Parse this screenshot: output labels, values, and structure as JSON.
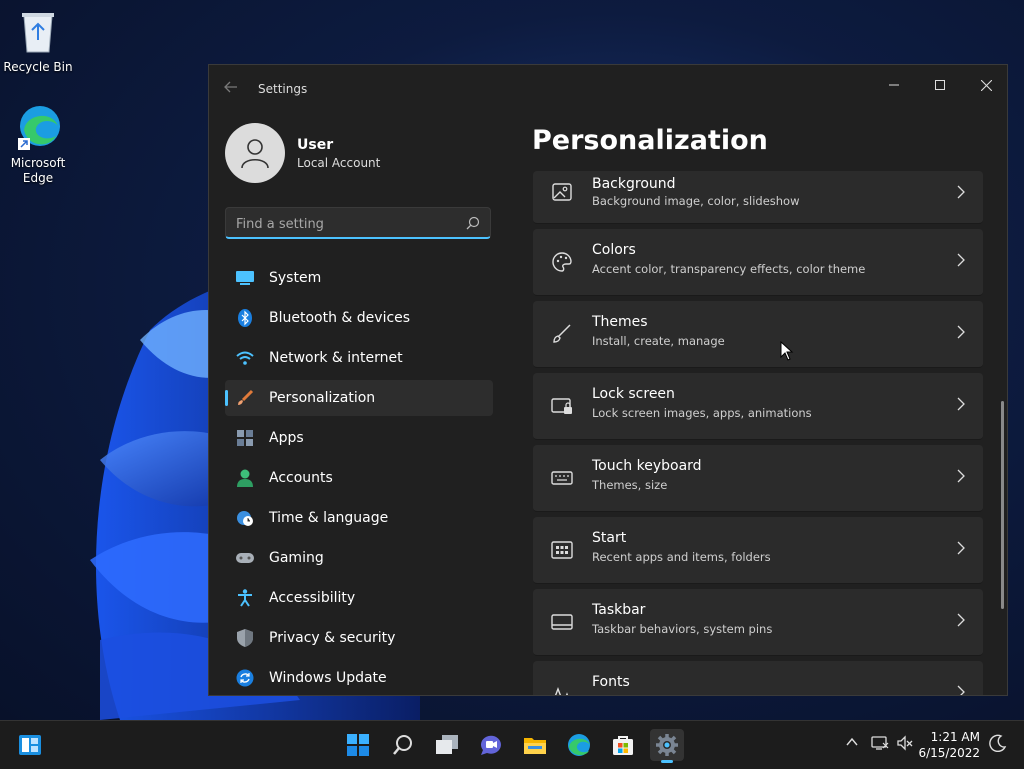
{
  "desktop": {
    "icons": [
      {
        "label": "Recycle Bin"
      },
      {
        "label": "Microsoft Edge"
      }
    ]
  },
  "window": {
    "title": "Settings",
    "user": {
      "name": "User",
      "account_type": "Local Account"
    },
    "search": {
      "placeholder": "Find a setting",
      "value": ""
    },
    "nav": [
      {
        "label": "System",
        "icon": "system-icon"
      },
      {
        "label": "Bluetooth & devices",
        "icon": "bluetooth-icon"
      },
      {
        "label": "Network & internet",
        "icon": "wifi-icon"
      },
      {
        "label": "Personalization",
        "icon": "brush-icon",
        "active": true
      },
      {
        "label": "Apps",
        "icon": "apps-icon"
      },
      {
        "label": "Accounts",
        "icon": "accounts-icon"
      },
      {
        "label": "Time & language",
        "icon": "globe-clock-icon"
      },
      {
        "label": "Gaming",
        "icon": "gamepad-icon"
      },
      {
        "label": "Accessibility",
        "icon": "accessibility-icon"
      },
      {
        "label": "Privacy & security",
        "icon": "shield-icon"
      },
      {
        "label": "Windows Update",
        "icon": "update-icon"
      }
    ],
    "page_title": "Personalization",
    "cards": [
      {
        "title": "Background",
        "subtitle": "Background image, color, slideshow",
        "icon": "image-icon"
      },
      {
        "title": "Colors",
        "subtitle": "Accent color, transparency effects, color theme",
        "icon": "palette-icon"
      },
      {
        "title": "Themes",
        "subtitle": "Install, create, manage",
        "icon": "brush-icon"
      },
      {
        "title": "Lock screen",
        "subtitle": "Lock screen images, apps, animations",
        "icon": "lock-screen-icon"
      },
      {
        "title": "Touch keyboard",
        "subtitle": "Themes, size",
        "icon": "keyboard-icon"
      },
      {
        "title": "Start",
        "subtitle": "Recent apps and items, folders",
        "icon": "start-icon"
      },
      {
        "title": "Taskbar",
        "subtitle": "Taskbar behaviors, system pins",
        "icon": "taskbar-icon"
      },
      {
        "title": "Fonts",
        "subtitle": "",
        "icon": "fonts-icon"
      }
    ]
  },
  "taskbar": {
    "apps": [
      "widgets-icon",
      "start-icon",
      "search-icon",
      "task-view-icon",
      "chat-icon",
      "file-explorer-icon",
      "edge-icon",
      "store-icon",
      "settings-icon"
    ],
    "active_app": "settings-icon",
    "tray": [
      "chevron-up-icon",
      "network-icon",
      "volume-muted-icon",
      "focus-assist-icon"
    ],
    "time": "1:21 AM",
    "date": "6/15/2022"
  },
  "colors": {
    "accent": "#4cc2ff",
    "window_bg": "#202020",
    "card_bg": "#2b2b2b",
    "active_nav_bg": "#2d2d2d"
  }
}
